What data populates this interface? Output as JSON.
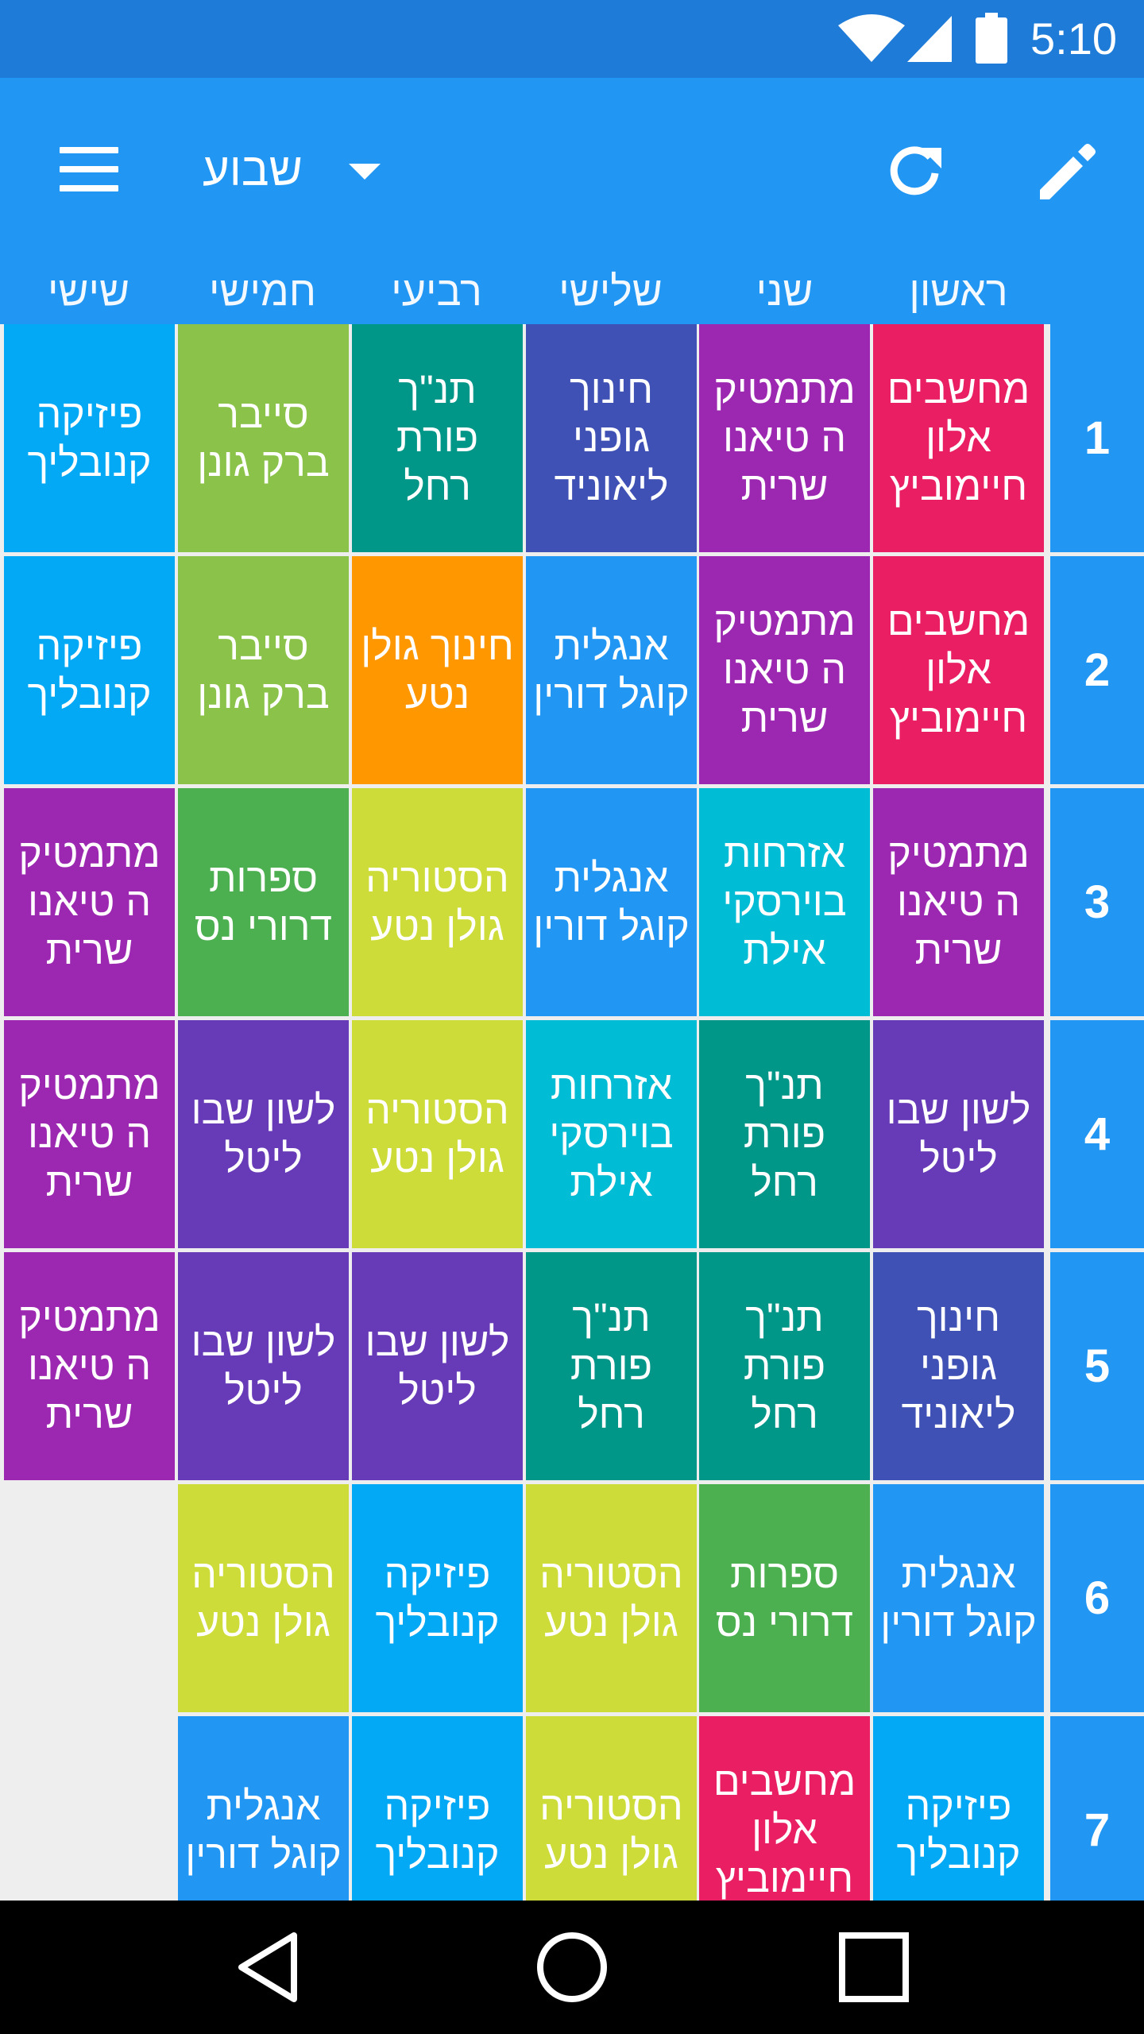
{
  "status_bar": {
    "time": "5:10",
    "icons": [
      "wifi-icon",
      "cell-signal-icon",
      "battery-icon"
    ]
  },
  "app_bar": {
    "menu_icon": "menu-icon",
    "view_selector": "שבוע",
    "actions": [
      "refresh-icon",
      "edit-icon"
    ],
    "color": "#2196F3"
  },
  "days": [
    "שישי",
    "חמישי",
    "רביעי",
    "שלישי",
    "שני",
    "ראשון"
  ],
  "hours": [
    "1",
    "2",
    "3",
    "4",
    "5",
    "6",
    "7"
  ],
  "schedule": [
    [
      {
        "text": "פיזיקה קנובליך",
        "color": "#03A9F4"
      },
      {
        "text": "סייבר ברק גונן",
        "color": "#8BC34A"
      },
      {
        "text": "תנ\"ך פורת רחל",
        "color": "#009688"
      },
      {
        "text": "חינוך גופני ליאוניד",
        "color": "#3F51B5"
      },
      {
        "text": "מתמטיקה טיאנו שרית",
        "color": "#9C27B0"
      },
      {
        "text": "מחשבים אלון חיימוביץ",
        "color": "#E91E63"
      }
    ],
    [
      {
        "text": "פיזיקה קנובליך",
        "color": "#03A9F4"
      },
      {
        "text": "סייבר ברק גונן",
        "color": "#8BC34A"
      },
      {
        "text": "חינוך גולן נטע",
        "color": "#FF9800"
      },
      {
        "text": "אנגלית קוגל דורין",
        "color": "#2196F3"
      },
      {
        "text": "מתמטיקה טיאנו שרית",
        "color": "#9C27B0"
      },
      {
        "text": "מחשבים אלון חיימוביץ",
        "color": "#E91E63"
      }
    ],
    [
      {
        "text": "מתמטיקה טיאנו שרית",
        "color": "#9C27B0"
      },
      {
        "text": "ספרות דרורי נס",
        "color": "#4CAF50"
      },
      {
        "text": "הסטוריה גולן נטע",
        "color": "#CDDC39"
      },
      {
        "text": "אנגלית קוגל דורין",
        "color": "#2196F3"
      },
      {
        "text": "אזרחות בוירסקי אילת",
        "color": "#00BCD4"
      },
      {
        "text": "מתמטיקה טיאנו שרית",
        "color": "#9C27B0"
      }
    ],
    [
      {
        "text": "מתמטיקה טיאנו שרית",
        "color": "#9C27B0"
      },
      {
        "text": "לשון שבו ליטל",
        "color": "#673AB7"
      },
      {
        "text": "הסטוריה גולן נטע",
        "color": "#CDDC39"
      },
      {
        "text": "אזרחות בוירסקי אילת",
        "color": "#00BCD4"
      },
      {
        "text": "תנ\"ך פורת רחל",
        "color": "#009688"
      },
      {
        "text": "לשון שבו ליטל",
        "color": "#673AB7"
      }
    ],
    [
      {
        "text": "מתמטיקה טיאנו שרית",
        "color": "#9C27B0"
      },
      {
        "text": "לשון שבו ליטל",
        "color": "#673AB7"
      },
      {
        "text": "לשון שבו ליטל",
        "color": "#673AB7"
      },
      {
        "text": "תנ\"ך פורת רחל",
        "color": "#009688"
      },
      {
        "text": "תנ\"ך פורת רחל",
        "color": "#009688"
      },
      {
        "text": "חינוך גופני ליאוניד",
        "color": "#3F51B5"
      }
    ],
    [
      null,
      {
        "text": "הסטוריה גולן נטע",
        "color": "#CDDC39"
      },
      {
        "text": "פיזיקה קנובליך",
        "color": "#03A9F4"
      },
      {
        "text": "הסטוריה גולן נטע",
        "color": "#CDDC39"
      },
      {
        "text": "ספרות דרורי נס",
        "color": "#4CAF50"
      },
      {
        "text": "אנגלית קוגל דורין",
        "color": "#2196F3"
      }
    ],
    [
      null,
      {
        "text": "אנגלית קוגל דורין",
        "color": "#2196F3"
      },
      {
        "text": "פיזיקה קנובליך",
        "color": "#03A9F4"
      },
      {
        "text": "הסטוריה גולן נטע",
        "color": "#CDDC39"
      },
      {
        "text": "מחשבים אלון חיימוביץ",
        "color": "#E91E63"
      },
      {
        "text": "פיזיקה קנובליך",
        "color": "#03A9F4"
      }
    ]
  ],
  "nav_bar": {
    "buttons": [
      "back-icon",
      "home-icon",
      "recents-icon"
    ]
  }
}
